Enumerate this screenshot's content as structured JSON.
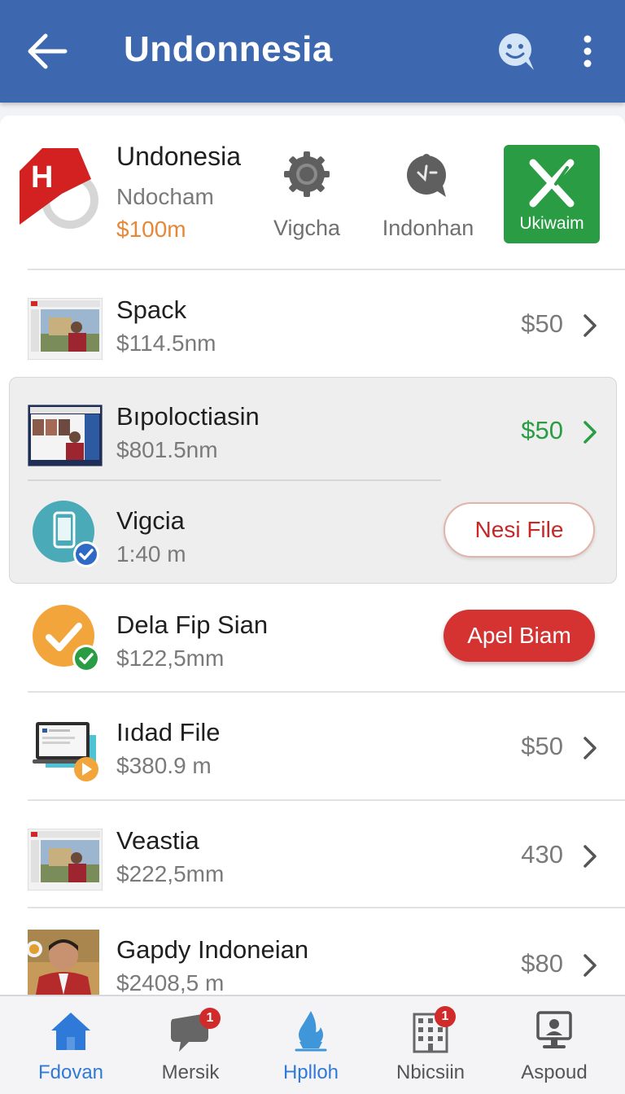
{
  "app_bar": {
    "title": "Undonnesia"
  },
  "header": {
    "name": "Undonesia",
    "subtitle": "Ndocham",
    "price": "$100m",
    "actions": [
      {
        "label": "Vigcha",
        "icon": "gear-icon"
      },
      {
        "label": "Indonhan",
        "icon": "support-agent-icon"
      }
    ],
    "green_button": {
      "label": "Ukiwaim",
      "icon": "x-check-icon"
    }
  },
  "rows": [
    {
      "title": "Spack",
      "subtitle": "$114.5nm",
      "price": "$50"
    },
    {
      "title": "Bıpoloctiasin",
      "subtitle": "$801.5nm",
      "price": "$50"
    },
    {
      "title": "Vigcia",
      "subtitle": "1:40 m",
      "button": "Nesi File"
    },
    {
      "title": "Dela Fip Sian",
      "subtitle": "$122,5mm",
      "button": "Apel Biam"
    },
    {
      "title": "Iıdad File",
      "subtitle": "$380.9 m",
      "price": "$50"
    },
    {
      "title": "Veastia",
      "subtitle": "$222,5mm",
      "price": "430"
    },
    {
      "title": "Gapdy Indoneian",
      "subtitle": "$2408,5 m",
      "price": "$80"
    }
  ],
  "bottom_nav": [
    {
      "label": "Fdovan",
      "icon": "home-icon",
      "active": true
    },
    {
      "label": "Mersik",
      "icon": "chat-icon",
      "badge": "1"
    },
    {
      "label": "Hplloh",
      "icon": "flame-icon"
    },
    {
      "label": "Nbicsiin",
      "icon": "building-icon",
      "badge": "1"
    },
    {
      "label": "Aspoud",
      "icon": "monitor-icon"
    }
  ],
  "colors": {
    "app_bar": "#3d68b0",
    "highlight_price": "#2a9d44",
    "header_price": "#e4883a",
    "accent_red": "#d53232",
    "nav_active": "#2f7ad8"
  }
}
